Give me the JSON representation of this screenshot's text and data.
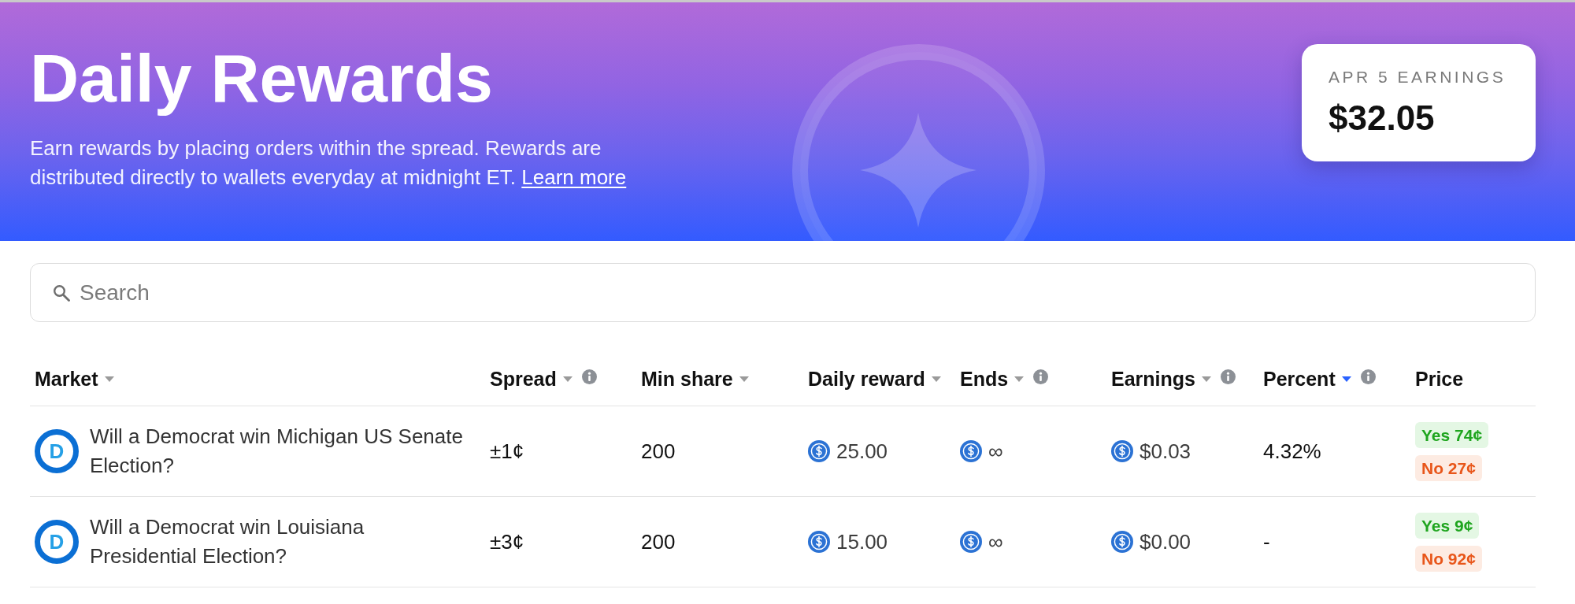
{
  "header": {
    "title": "Daily Rewards",
    "description": "Earn rewards by placing orders within the spread. Rewards are distributed directly to wallets everyday at midnight ET.",
    "link": "Learn more"
  },
  "earnings_card": {
    "label": "APR 5 EARNINGS",
    "value": "$32.05"
  },
  "search": {
    "placeholder": "Search"
  },
  "table": {
    "columns": [
      {
        "label": "Market",
        "sortable": true,
        "sorted": false,
        "info": false
      },
      {
        "label": "Spread",
        "sortable": true,
        "sorted": false,
        "info": true
      },
      {
        "label": "Min share",
        "sortable": true,
        "sorted": false,
        "info": false
      },
      {
        "label": "Daily reward",
        "sortable": true,
        "sorted": false,
        "info": false
      },
      {
        "label": "Ends",
        "sortable": true,
        "sorted": false,
        "info": true
      },
      {
        "label": "Earnings",
        "sortable": true,
        "sorted": false,
        "info": true
      },
      {
        "label": "Percent",
        "sortable": true,
        "sorted": true,
        "info": true
      },
      {
        "label": "Price",
        "sortable": false,
        "sorted": false,
        "info": false
      }
    ],
    "rows": [
      {
        "logo": "D",
        "market": "Will a Democrat win Michigan US Senate Election?",
        "spread": "±1¢",
        "min_share": "200",
        "daily_reward": "25.00",
        "ends": "∞",
        "earnings": "$0.03",
        "percent": "4.32%",
        "prices": [
          {
            "kind": "yes",
            "label": "Yes 74¢"
          },
          {
            "kind": "no",
            "label": "No 27¢"
          }
        ]
      },
      {
        "logo": "D",
        "market": "Will a Democrat win Louisiana Presidential Election?",
        "spread": "±3¢",
        "min_share": "200",
        "daily_reward": "15.00",
        "ends": "∞",
        "earnings": "$0.00",
        "percent": "-",
        "prices": [
          {
            "kind": "yes",
            "label": "Yes 9¢"
          },
          {
            "kind": "no",
            "label": "No 92¢"
          }
        ]
      }
    ]
  }
}
